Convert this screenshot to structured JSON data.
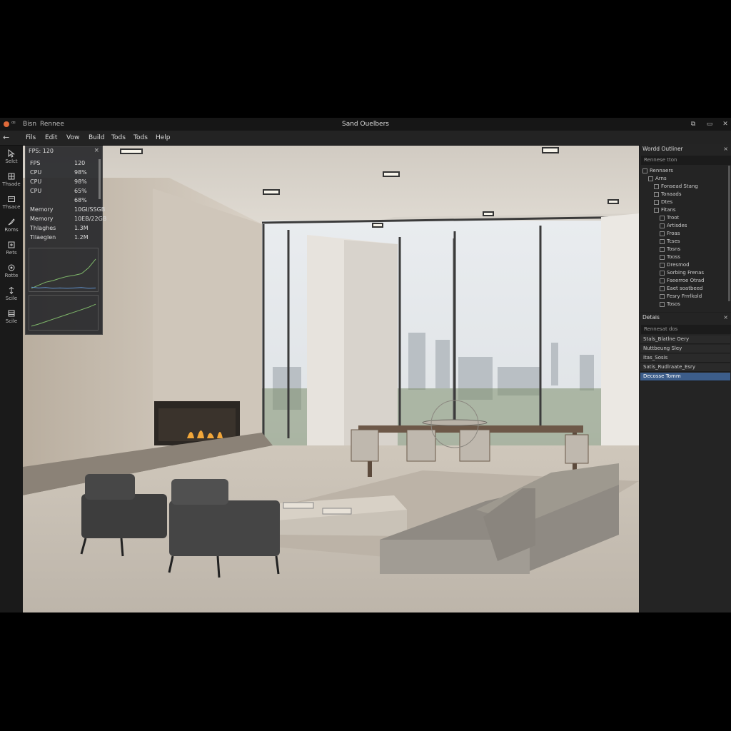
{
  "window": {
    "app_symbol": "ꟹ",
    "app_name": "Bisn",
    "doc_name": "Rennee",
    "title": "Sand Ouelbers",
    "restore_glyph": "⧉",
    "minimize_glyph": "▭",
    "close_glyph": "✕"
  },
  "menu": {
    "back_glyph": "←",
    "items": [
      "Fils",
      "Edit",
      "Vow",
      "Build",
      "Tods",
      "Tods",
      "Help"
    ]
  },
  "tools": [
    {
      "label": "Selct",
      "icon": "select-cursor-icon"
    },
    {
      "label": "Thsade",
      "icon": "shade-icon"
    },
    {
      "label": "Thsace",
      "icon": "frame-icon"
    },
    {
      "label": "Roms",
      "icon": "brush-icon"
    },
    {
      "label": "Rets",
      "icon": "transform-icon"
    },
    {
      "label": "Rotte",
      "icon": "rotate-icon"
    },
    {
      "label": "Scile",
      "icon": "scale-icon"
    },
    {
      "label": "Scile",
      "icon": "grid-icon"
    }
  ],
  "stats": {
    "header": "FPS: 120",
    "close_glyph": "×",
    "rows": [
      {
        "k": "FPS",
        "v": "120"
      },
      {
        "k": "CPU",
        "v": "98%"
      },
      {
        "k": "CPU",
        "v": "98%"
      },
      {
        "k": "CPU",
        "v": "65%"
      },
      {
        "k": "",
        "v": "68%"
      },
      {
        "k": "Memory",
        "v": "10GI/SSGB"
      },
      {
        "k": "Memory",
        "v": "10EB/22GB"
      },
      {
        "k": "Thlaghes",
        "v": "1.3M"
      },
      {
        "k": "Tilaeglen",
        "v": "1.2M"
      }
    ],
    "chart1": {
      "x": [
        0,
        1,
        2,
        3,
        4,
        5,
        6,
        7,
        8,
        9
      ],
      "y": [
        2,
        10,
        18,
        22,
        28,
        33,
        36,
        40,
        55,
        78
      ],
      "y2": [
        5,
        3,
        4,
        2,
        3,
        2,
        3,
        4,
        2,
        3
      ]
    },
    "chart2": {
      "x": [
        0,
        1,
        2,
        3,
        4,
        5,
        6,
        7,
        8,
        9
      ],
      "y": [
        5,
        12,
        20,
        28,
        36,
        44,
        52,
        60,
        68,
        78
      ]
    }
  },
  "outliner": {
    "title": "Wordd Outliner",
    "close_glyph": "×",
    "search": "Rennese tton",
    "rows": [
      {
        "label": "Rennaers",
        "depth": 0
      },
      {
        "label": "Arns",
        "depth": 1
      },
      {
        "label": "Fonsead Stang",
        "depth": 2
      },
      {
        "label": "Tonaads",
        "depth": 2
      },
      {
        "label": "Dtes",
        "depth": 2
      },
      {
        "label": "Fitans",
        "depth": 2
      },
      {
        "label": "Troot",
        "depth": 3
      },
      {
        "label": "Artisdes",
        "depth": 3
      },
      {
        "label": "Froas",
        "depth": 3
      },
      {
        "label": "Tcses",
        "depth": 3
      },
      {
        "label": "Tosns",
        "depth": 3
      },
      {
        "label": "Tooss",
        "depth": 3
      },
      {
        "label": "Dresmod",
        "depth": 3
      },
      {
        "label": "Sorbing Frenas",
        "depth": 3
      },
      {
        "label": "Fseerroe Otrad",
        "depth": 3
      },
      {
        "label": "Eaet soatbeed",
        "depth": 3
      },
      {
        "label": "Fesry Frrrlkold",
        "depth": 3
      },
      {
        "label": "Tosos",
        "depth": 3
      }
    ]
  },
  "details": {
    "title": "Detais",
    "close_glyph": "×",
    "search": "Rennesat dos",
    "rows": [
      {
        "label": "Stals_Blatlne Oery",
        "selected": false
      },
      {
        "label": "Nuttbeung Sley",
        "selected": false
      },
      {
        "label": "Itas_Sosis",
        "selected": false
      },
      {
        "label": "Satis_Rudlraate_Esry",
        "selected": false
      },
      {
        "label": "Decosse Tomm",
        "selected": true
      }
    ]
  },
  "colors": {
    "accent": "#3c5d8a",
    "close_dot": "#e06a3a",
    "graph_green": "#7fb86a",
    "graph_blue": "#5f8fc8"
  }
}
